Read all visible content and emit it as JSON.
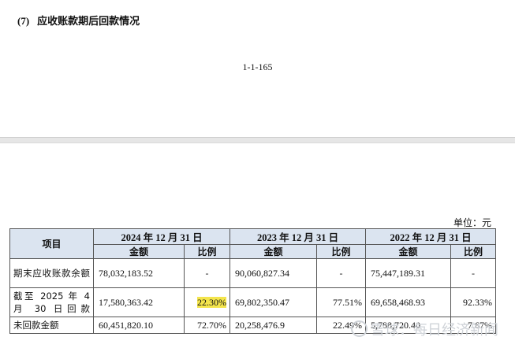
{
  "section": {
    "number": "(7)",
    "title": "应收账款期后回款情况"
  },
  "page_number": "1-1-165",
  "unit_label": "单位：元",
  "table": {
    "item_header": "项目",
    "periods": [
      "2024 年 12 月 31 日",
      "2023 年 12 月 31 日",
      "2022 年 12 月 31 日"
    ],
    "amount_header": "金额",
    "ratio_header": "比例",
    "rows": [
      {
        "label": "期末应收账款余额",
        "cells": [
          {
            "amount": "78,032,183.52",
            "ratio": "-"
          },
          {
            "amount": "90,060,827.34",
            "ratio": "-"
          },
          {
            "amount": "75,447,189.31",
            "ratio": "-"
          }
        ]
      },
      {
        "label": "截至 2025 年 4 月 30 日回款",
        "cells": [
          {
            "amount": "17,580,363.42",
            "ratio": "22.30%"
          },
          {
            "amount": "69,802,350.47",
            "ratio": "77.51%"
          },
          {
            "amount": "69,658,468.93",
            "ratio": "92.33%"
          }
        ]
      },
      {
        "label": "未回款金额",
        "cells": [
          {
            "amount": "60,451,820.10",
            "ratio": "72.70%"
          },
          {
            "amount": "20,258,476.9",
            "ratio": "22.49%"
          },
          {
            "amount": "5,788,720.40",
            "ratio": "7.67%"
          }
        ]
      }
    ]
  },
  "watermark": "雪球：每日经济新闻",
  "highlight_color": "#f4e54c",
  "header_bg_color": "#dbe4f0"
}
